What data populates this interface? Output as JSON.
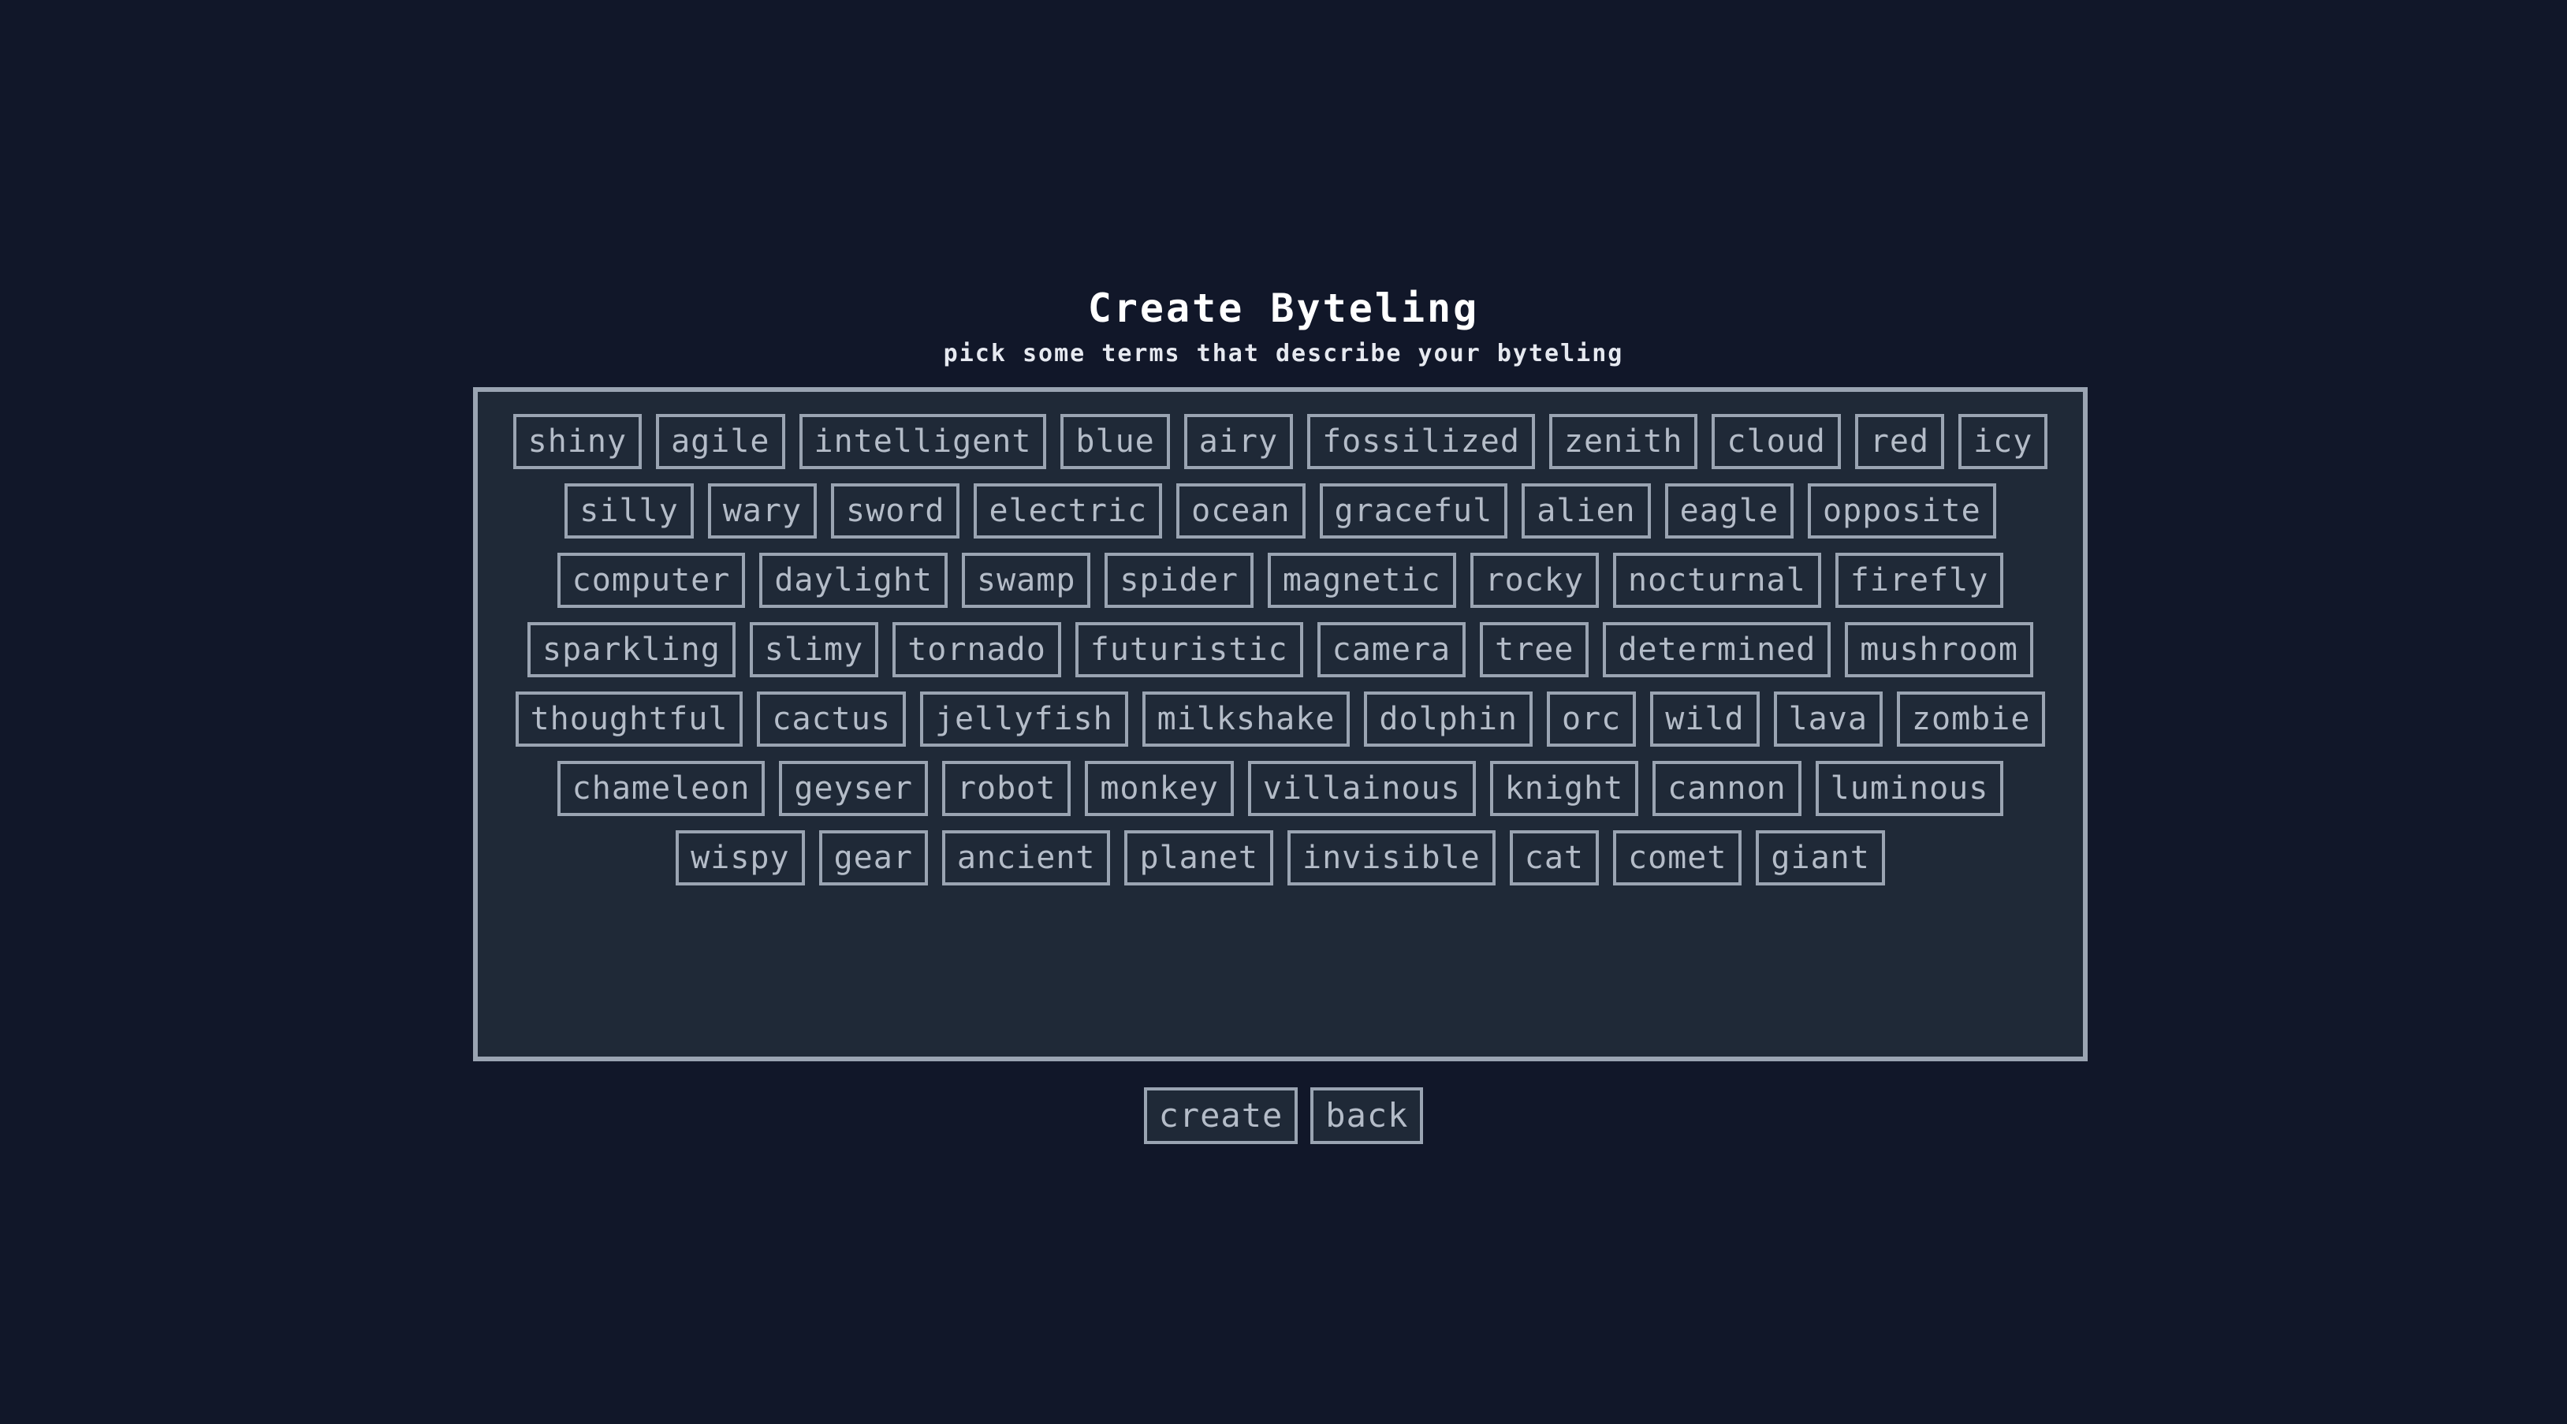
{
  "header": {
    "title": "Create Byteling",
    "subtitle": "pick some terms that describe your byteling"
  },
  "terms": [
    "shiny",
    "agile",
    "intelligent",
    "blue",
    "airy",
    "fossilized",
    "zenith",
    "cloud",
    "red",
    "icy",
    "silly",
    "wary",
    "sword",
    "electric",
    "ocean",
    "graceful",
    "alien",
    "eagle",
    "opposite",
    "computer",
    "daylight",
    "swamp",
    "spider",
    "magnetic",
    "rocky",
    "nocturnal",
    "firefly",
    "sparkling",
    "slimy",
    "tornado",
    "futuristic",
    "camera",
    "tree",
    "determined",
    "mushroom",
    "thoughtful",
    "cactus",
    "jellyfish",
    "milkshake",
    "dolphin",
    "orc",
    "wild",
    "lava",
    "zombie",
    "chameleon",
    "geyser",
    "robot",
    "monkey",
    "villainous",
    "knight",
    "cannon",
    "luminous",
    "wispy",
    "gear",
    "ancient",
    "planet",
    "invisible",
    "cat",
    "comet",
    "giant"
  ],
  "actions": {
    "create_label": "create",
    "back_label": "back"
  },
  "colors": {
    "background": "#111729",
    "panel": "#1f2937",
    "border": "#9aa4b2",
    "text": "#b4bcc8",
    "title": "#ffffff"
  }
}
